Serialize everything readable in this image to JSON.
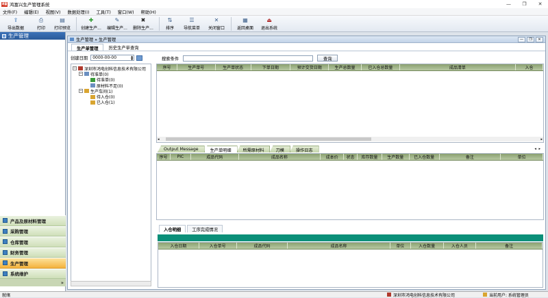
{
  "window": {
    "title": "鸿富兴生产管理系统",
    "logo": "鸿富",
    "controls": [
      "—",
      "❐",
      "✕"
    ]
  },
  "menu": [
    "文件(F)",
    "编辑(E)",
    "视图(V)",
    "数据处理(I)",
    "工具(T)",
    "窗口(W)",
    "帮助(H)"
  ],
  "toolbar": [
    {
      "label": "导出数据",
      "icon": "export-icon",
      "glyph": "⇪"
    },
    {
      "label": "打印",
      "icon": "print-icon",
      "glyph": "⎙"
    },
    {
      "label": "打印预览",
      "icon": "print-preview-icon",
      "glyph": "▤"
    },
    {
      "label": "创建生产...",
      "icon": "add-icon",
      "glyph": "✚"
    },
    {
      "label": "编辑生产...",
      "icon": "edit-icon",
      "glyph": "✎"
    },
    {
      "label": "删除生产...",
      "icon": "delete-icon",
      "glyph": "✖"
    },
    {
      "label": "排序",
      "icon": "sort-icon",
      "glyph": "⇅"
    },
    {
      "label": "导航菜单",
      "icon": "nav-menu-icon",
      "glyph": "☰"
    },
    {
      "label": "关闭窗口",
      "icon": "close-window-icon",
      "glyph": "✕"
    },
    {
      "label": "返回桌面",
      "icon": "desktop-icon",
      "glyph": "▦"
    },
    {
      "label": "退出系统",
      "icon": "exit-icon",
      "glyph": "⏏"
    }
  ],
  "left": {
    "header": "生产管理",
    "nav": [
      "产品及原材料管理",
      "采购管理",
      "仓库管理",
      "财务管理",
      "生产管理",
      "系统维护"
    ],
    "nav_active": "生产管理",
    "more": "»"
  },
  "mdi": {
    "title": "生产管理 » 生产管理"
  },
  "subtabs": [
    "生产单管理",
    "历史生产单查询"
  ],
  "filter": {
    "label": "创建日期",
    "value": "0000-00-00"
  },
  "tree": [
    {
      "text": "深圳市鸿电创科信息技术有限公司",
      "level": 0,
      "exp": "−",
      "icon": "company-icon",
      "color": "#b03a2e"
    },
    {
      "text": "待准单(0)",
      "level": 1,
      "exp": "−",
      "icon": "folder-icon",
      "color": "#6b8fc0"
    },
    {
      "text": "待准单(0)",
      "level": 2,
      "exp": "",
      "icon": "green-item-icon",
      "color": "#3a9b3a"
    },
    {
      "text": "原材料不足(0)",
      "level": 2,
      "exp": "",
      "icon": "list-item-icon",
      "color": "#6b8fc0"
    },
    {
      "text": "生产车间(1)",
      "level": 1,
      "exp": "−",
      "icon": "workshop-icon",
      "color": "#d9a531"
    },
    {
      "text": "待入仓(0)",
      "level": 2,
      "exp": "",
      "icon": "box-icon",
      "color": "#d9a531"
    },
    {
      "text": "已入仓(1)",
      "level": 2,
      "exp": "",
      "icon": "box-icon",
      "color": "#d9a531"
    }
  ],
  "search": {
    "label": "搜索条件",
    "button": "查询"
  },
  "grid1": {
    "columns": [
      "序号",
      "生产单号",
      "生产单状态",
      "下单日期",
      "预计交货日期",
      "生产总数量",
      "已入仓总数量",
      "成品清单",
      "入仓"
    ]
  },
  "bottom_tabs": [
    "Output Message",
    "生产单明细",
    "所需原材料",
    "刀模",
    "操作日志"
  ],
  "bottom_tab_active": "生产单明细",
  "tab_arrows": "◂ ▸",
  "grid2": {
    "columns": [
      "序号",
      "PIC",
      "成品代码",
      "成品名称",
      "成本价",
      "状态",
      "库存数量",
      "生产数量",
      "已入仓数量",
      "备注",
      "单位"
    ]
  },
  "panel3tabs": [
    "入仓明细",
    "工序完成情况"
  ],
  "grid3": {
    "columns": [
      "入仓日期",
      "入仓单号",
      "成品代码",
      "成品名称",
      "单位",
      "入仓数量",
      "入仓人员",
      "备注"
    ]
  },
  "status": {
    "left": "就绪",
    "company": "深圳市鸿电创科信息技术有限公司",
    "user": "当前用户: 系统管理员"
  }
}
